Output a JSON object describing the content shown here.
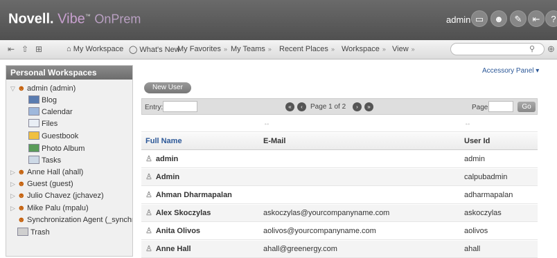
{
  "header": {
    "brand": "Novell.",
    "product": "Vibe",
    "trademark": "™",
    "edition": "OnPrem",
    "user": "admin",
    "icons": [
      "desktop-icon",
      "profile-icon",
      "notes-icon",
      "logout-icon",
      "help-icon"
    ]
  },
  "toolbar": {
    "items": [
      {
        "label": "My Workspace",
        "icon": "home-icon"
      },
      {
        "label": "What's New",
        "icon": "whats-new-icon"
      },
      {
        "label": "My Favorites",
        "menu": true
      },
      {
        "label": "My Teams",
        "menu": true
      },
      {
        "label": "Recent Places",
        "menu": true
      },
      {
        "label": "Workspace",
        "menu": true
      },
      {
        "label": "View",
        "menu": true
      }
    ],
    "search": {
      "value": "",
      "placeholder": ""
    }
  },
  "sidebar": {
    "title": "Personal Workspaces",
    "tree": [
      {
        "label": "admin (admin)",
        "type": "person",
        "expanded": true
      },
      {
        "label": "Blog",
        "type": "blog"
      },
      {
        "label": "Calendar",
        "type": "calendar"
      },
      {
        "label": "Files",
        "type": "files"
      },
      {
        "label": "Guestbook",
        "type": "guestbook"
      },
      {
        "label": "Photo Album",
        "type": "photo"
      },
      {
        "label": "Tasks",
        "type": "tasks"
      },
      {
        "label": "Anne Hall (ahall)",
        "type": "person"
      },
      {
        "label": "Guest (guest)",
        "type": "person"
      },
      {
        "label": "Julio Chavez (jchavez)",
        "type": "person"
      },
      {
        "label": "Mike Palu (mpalu)",
        "type": "person"
      },
      {
        "label": "Synchronization Agent (_synchroniz",
        "type": "person"
      },
      {
        "label": "Trash",
        "type": "trash"
      }
    ]
  },
  "main": {
    "accessory_panel": "Accessory Panel",
    "new_user_button": "New User",
    "pagination": {
      "entry_label": "Entry:",
      "entry_value": "",
      "page_text": "Page 1 of 2",
      "page_label": "Page:",
      "page_value": "",
      "go_label": "Go"
    },
    "resize_glyph": "↔",
    "columns": [
      "Full Name",
      "E-Mail",
      "User Id"
    ],
    "rows": [
      {
        "name": "admin",
        "email": "",
        "userid": "admin"
      },
      {
        "name": "Admin",
        "email": "",
        "userid": "calpubadmin"
      },
      {
        "name": "Ahman Dharmapalan",
        "email": "",
        "userid": "adharmapalan"
      },
      {
        "name": "Alex Skoczylas",
        "email": "askoczylas@yourcompanyname.com",
        "userid": "askoczylas"
      },
      {
        "name": "Anita Olivos",
        "email": "aolivos@yourcompanyname.com",
        "userid": "aolivos"
      },
      {
        "name": "Anne Hall",
        "email": "ahall@greenergy.com",
        "userid": "ahall"
      }
    ]
  }
}
